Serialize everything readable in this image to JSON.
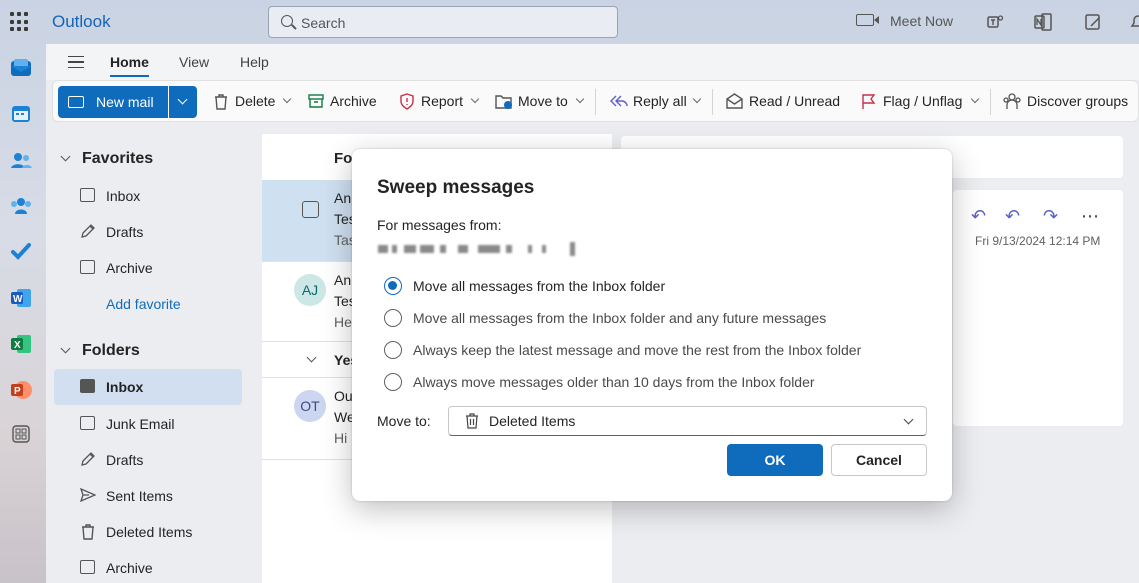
{
  "app": {
    "title": "Outlook"
  },
  "search": {
    "placeholder": "Search"
  },
  "topbar": {
    "meet_now": "Meet Now"
  },
  "ribbon": {
    "tabs": [
      {
        "label": "Home"
      },
      {
        "label": "View"
      },
      {
        "label": "Help"
      }
    ],
    "toolbar": {
      "new_mail": "New mail",
      "delete": "Delete",
      "archive": "Archive",
      "report": "Report",
      "move_to": "Move to",
      "reply_all": "Reply all",
      "read_unread": "Read / Unread",
      "flag_unflag": "Flag / Unflag",
      "discover_groups": "Discover groups"
    }
  },
  "folders": {
    "favorites_header": "Favorites",
    "favorites": [
      {
        "label": "Inbox",
        "icon": "inbox-icon"
      },
      {
        "label": "Drafts",
        "icon": "pencil-icon"
      },
      {
        "label": "Archive",
        "icon": "archive-icon"
      }
    ],
    "add_favorite": "Add favorite",
    "folders_header": "Folders",
    "items": [
      {
        "label": "Inbox",
        "icon": "inbox-icon",
        "selected": true
      },
      {
        "label": "Junk Email",
        "icon": "junk-icon"
      },
      {
        "label": "Drafts",
        "icon": "pencil-icon"
      },
      {
        "label": "Sent Items",
        "icon": "send-icon"
      },
      {
        "label": "Deleted Items",
        "icon": "trash-icon"
      },
      {
        "label": "Archive",
        "icon": "archive-icon"
      }
    ]
  },
  "message_list": {
    "tab_label": "Fo",
    "rows": [
      {
        "line1": "An",
        "line2": "Tes",
        "line3": "Tas"
      },
      {
        "avatar": "AJ",
        "line1": "An",
        "line2": "Tes",
        "line3": "He"
      },
      {
        "group": "Yes"
      },
      {
        "avatar": "OT",
        "line1": "Ou",
        "line2": "We",
        "line3": "Hi"
      }
    ]
  },
  "reading_pane": {
    "date": "Fri 9/13/2024 12:14 PM"
  },
  "dialog": {
    "title": "Sweep messages",
    "from_label": "For messages from:",
    "options": [
      {
        "label": "Move all messages from the Inbox folder",
        "checked": true
      },
      {
        "label": "Move all messages from the Inbox folder and any future messages",
        "checked": false
      },
      {
        "label": "Always keep the latest message and move the rest from the Inbox folder",
        "checked": false
      },
      {
        "label": "Always move messages older than 10 days from the Inbox folder",
        "checked": false
      }
    ],
    "move_to_label": "Move to:",
    "move_to_value": "Deleted Items",
    "ok": "OK",
    "cancel": "Cancel"
  },
  "colors": {
    "accent": "#0f6cbd",
    "selected_folder": "#d1dff0"
  }
}
